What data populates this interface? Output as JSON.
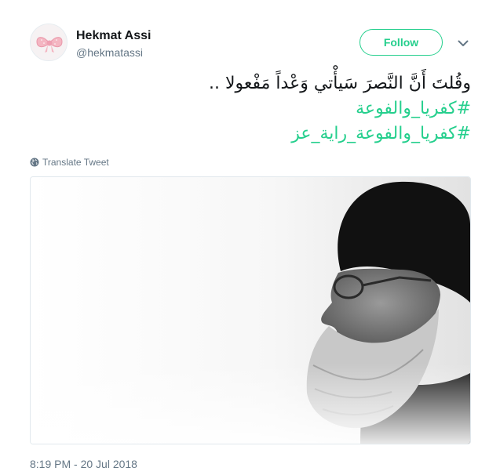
{
  "user": {
    "display_name": "Hekmat Assi",
    "screen_name": "@hekmatassi",
    "avatar_icon": "pink-bow-avatar"
  },
  "actions": {
    "follow_label": "Follow",
    "more_icon": "chevron-down-icon"
  },
  "tweet": {
    "text_line": "وقُلتَ أَنَّ النَّصرَ سَيأْتي وَعْداً مَفْعولا ..",
    "hashtags": [
      "#كفريا_والفوعة",
      "#كفريا_والفوعة_راية_عز"
    ],
    "translate_label": "Translate Tweet",
    "translate_icon": "globe-icon",
    "media_alt": "black-and-white-portrait-photo",
    "timestamp": "8:19 PM - 20 Jul 2018"
  },
  "colors": {
    "accent": "#25cf8d",
    "secondary_text": "#657786",
    "primary_text": "#14171a"
  }
}
